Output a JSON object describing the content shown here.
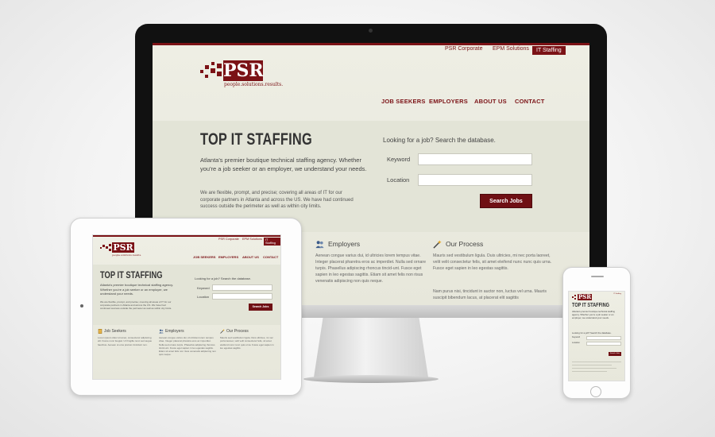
{
  "site": {
    "utility_nav": [
      "PSR Corporate",
      "EPM Solutions",
      "IT Staffing"
    ],
    "logo_text": "PSR",
    "logo_tagline": "people.solutions.results.",
    "main_nav": [
      "JOB SEEKERS",
      "EMPLOYERS",
      "ABOUT US",
      "CONTACT"
    ],
    "hero_title": "TOP IT STAFFING",
    "hero_lead": "Atlanta's premier boutique technical staffing agency.  Whether you're a job seeker or an employer, we understand your needs.",
    "hero_body": "We are flexible, prompt, and precise; covering all areas of IT for our corporate partners in Atlanta and across the US.  We have had continued success outside the perimeter as well as within city limits.",
    "search": {
      "heading": "Looking for a job?  Search the database.",
      "keyword_label": "Keyword",
      "location_label": "Location",
      "button": "Search Jobs"
    },
    "columns": {
      "job_seekers": {
        "title": "Job Seekers",
        "text": "Lorem ipsum dolor sit amet, consectetur adipiscing elit. Fusce nunc feugiat.  Ut fringilla nunc sed augue faucibus. Aenean ut eros pretium tincidunt non."
      },
      "employers": {
        "title": "Employers",
        "text": "Aenean congue varius dui, id ultricies lorem tempus vitae. Integer placerat pharetra eros ac imperdiet. Nulla sed ornare turpis. Phasellus adipiscing rhoncus tincid-unt. Fusce eget sapien in leo egestas sagittis. Etiam sit amet felis non risus venenatis adipiscing non quis neque."
      },
      "our_process": {
        "title": "Our Process",
        "text": "Mauris sed vestibulum ligula. Duis ultricies, mi nec porta laoreet, velit velit consectetur felis, sit amet eleifend nunc nunc quis urna. Fusce eget sapien in leo egestas sagittis.",
        "text2": "Nam purus nisi, tincidunt in auctor non, luctus vel urna. Mauris suscipit bibendum lacus, at placerat elit sagittis"
      }
    }
  },
  "colors": {
    "brand": "#7b1216",
    "background": "#e7e7db"
  },
  "icons": {
    "job_seekers": "document-icon",
    "employers": "people-icon",
    "our_process": "magic-wand-icon"
  }
}
